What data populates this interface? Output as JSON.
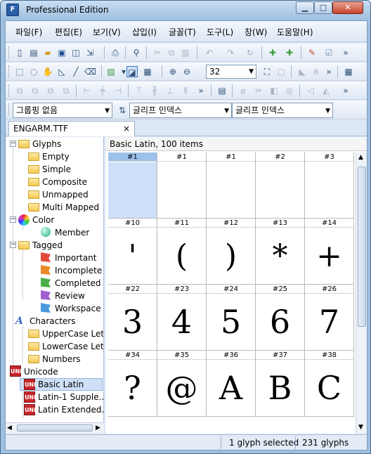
{
  "window": {
    "title": "Professional Edition",
    "app_icon": "F"
  },
  "menu": [
    "파일(F)",
    "편집(E)",
    "보기(V)",
    "삽입(I)",
    "글꼴(T)",
    "도구(L)",
    "창(W)",
    "도움말(H)"
  ],
  "toolbar": {
    "zoom": "32",
    "more": "»"
  },
  "combos": {
    "group": "그룹핑 없음",
    "index1": "글리프 인덱스",
    "index2": "글리프 인덱스"
  },
  "tab": {
    "label": "ENGARM.TTF",
    "close": "×"
  },
  "tree": {
    "glyphs": "Glyphs",
    "empty": "Empty",
    "simple": "Simple",
    "composite": "Composite",
    "unmapped": "Unmapped",
    "multi_mapped": "Multi Mapped",
    "color": "Color",
    "member": "Member",
    "tagged": "Tagged",
    "important": "Important",
    "incomplete": "Incomplete",
    "completed": "Completed",
    "review": "Review",
    "workspace": "Workspace",
    "characters": "Characters",
    "uppercase": "UpperCase Lett...",
    "lowercase": "LowerCase Lett...",
    "numbers": "Numbers",
    "unicode": "Unicode",
    "basic_latin": "Basic Latin",
    "latin1": "Latin-1 Supple...",
    "latin_ext": "Latin Extended...",
    "unicode_badge": "UNI"
  },
  "grid": {
    "header": "Basic Latin, 100 items",
    "rows": [
      [
        {
          "n": "#1",
          "g": ""
        },
        {
          "n": "#1",
          "g": ""
        },
        {
          "n": "#1",
          "g": ""
        },
        {
          "n": "#2",
          "g": ""
        },
        {
          "n": "#3",
          "g": ""
        }
      ],
      [
        {
          "n": "#10",
          "g": "'"
        },
        {
          "n": "#11",
          "g": "("
        },
        {
          "n": "#12",
          "g": ")"
        },
        {
          "n": "#13",
          "g": "*"
        },
        {
          "n": "#14",
          "g": "+"
        }
      ],
      [
        {
          "n": "#22",
          "g": "3"
        },
        {
          "n": "#23",
          "g": "4"
        },
        {
          "n": "#24",
          "g": "5"
        },
        {
          "n": "#25",
          "g": "6"
        },
        {
          "n": "#26",
          "g": "7"
        }
      ],
      [
        {
          "n": "#34",
          "g": "?"
        },
        {
          "n": "#35",
          "g": "@"
        },
        {
          "n": "#36",
          "g": "A"
        },
        {
          "n": "#37",
          "g": "B"
        },
        {
          "n": "#38",
          "g": "C"
        }
      ]
    ]
  },
  "status": {
    "selected": "1 glyph selected",
    "count": "231 glyphs"
  },
  "colors": {
    "accent": "#3a78c4",
    "selection": "#cde0f7",
    "title_gradient_top": "#c9def2"
  }
}
